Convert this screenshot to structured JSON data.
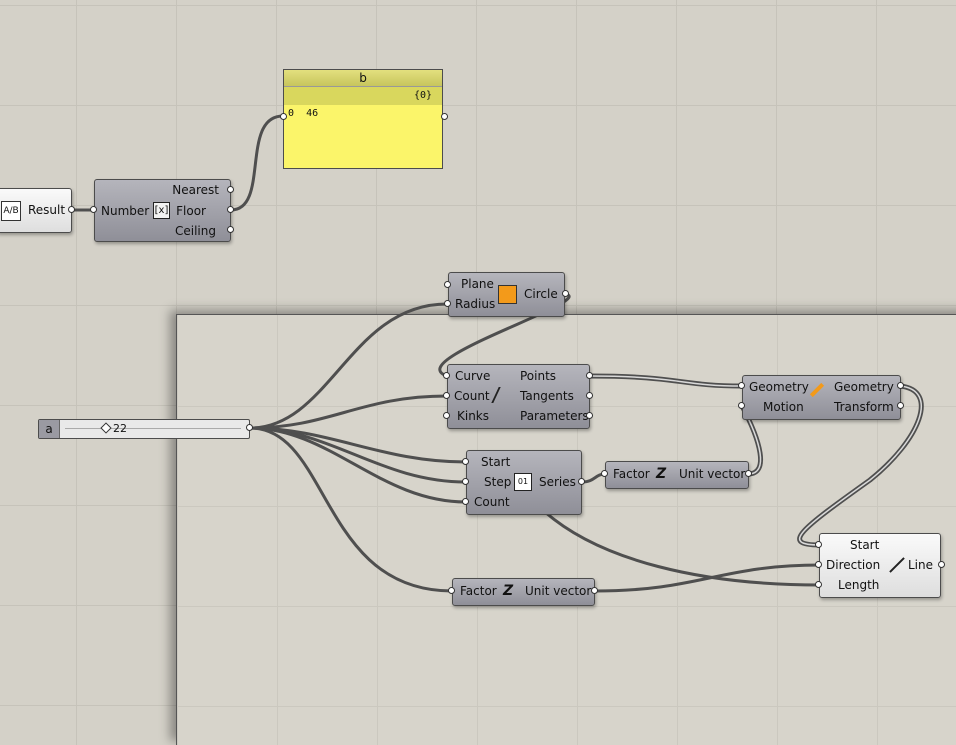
{
  "canvas": {
    "panel_b": {
      "title": "b",
      "path": "{0}",
      "index": "0",
      "value": "46"
    },
    "result_param": {
      "label": "Result"
    },
    "round": {
      "input": "Number",
      "outputs": [
        "Nearest",
        "Floor",
        "Ceiling"
      ]
    },
    "circle": {
      "inputs": [
        "Plane",
        "Radius"
      ],
      "output": "Circle"
    },
    "divide_curve": {
      "inputs": [
        "Curve",
        "Count",
        "Kinks"
      ],
      "outputs": [
        "Points",
        "Tangents",
        "Parameters"
      ]
    },
    "series": {
      "inputs": [
        "Start",
        "Step",
        "Count"
      ],
      "output": "Series"
    },
    "unit_z_1": {
      "input": "Factor",
      "output": "Unit vector"
    },
    "unit_z_2": {
      "input": "Factor",
      "output": "Unit vector"
    },
    "move": {
      "inputs": [
        "Geometry",
        "Motion"
      ],
      "outputs": [
        "Geometry",
        "Transform"
      ]
    },
    "line_sdl": {
      "inputs": [
        "Start",
        "Direction",
        "Length"
      ],
      "output": "Line"
    },
    "slider": {
      "name": "a",
      "value": "22"
    }
  },
  "colors": {
    "canvas": "#d4d1c8",
    "component": "#9d9da5",
    "panel": "#fbf56a",
    "wire": "#4f4f4f"
  }
}
